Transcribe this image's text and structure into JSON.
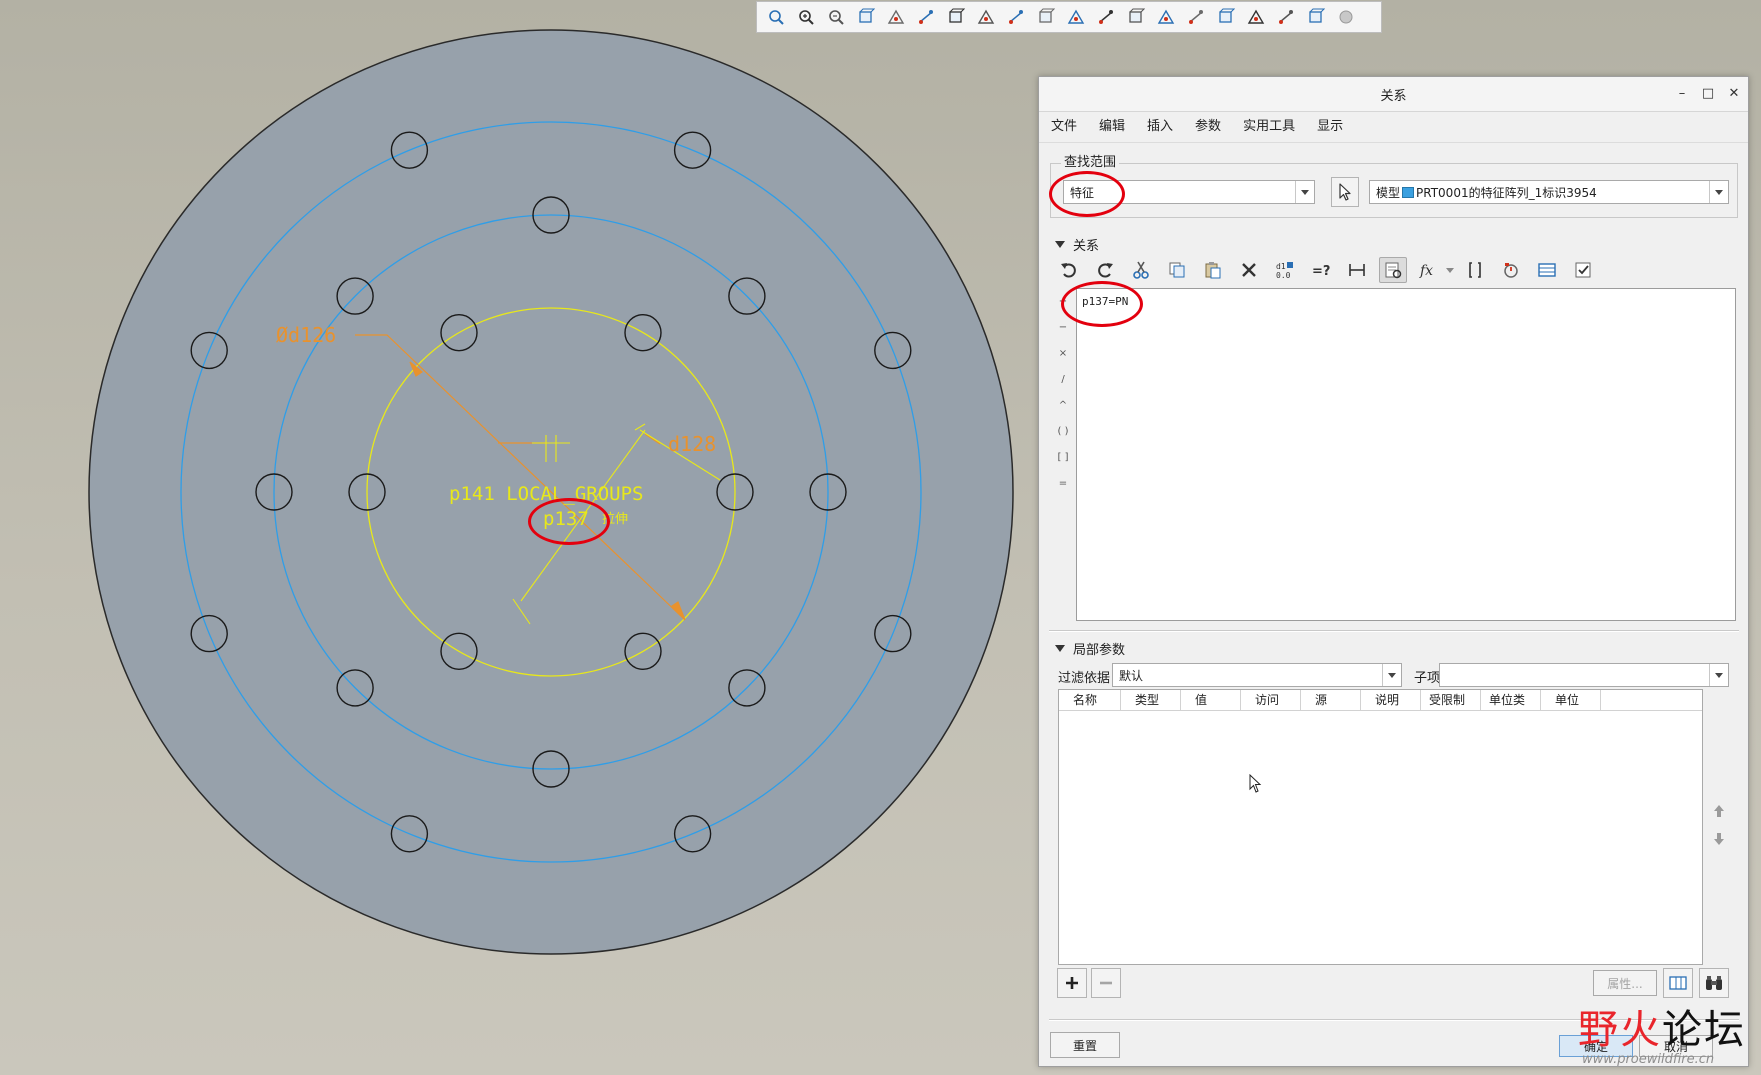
{
  "colors": {
    "disc": "#97a1ab",
    "hole_stroke": "#1a1a1a",
    "bolt_circle": "#2f9ee8",
    "sketch": "#e8e81a",
    "dimension": "#e8922e",
    "highlight": "#e3000e"
  },
  "model": {
    "dim_diameter_label": "Ød126",
    "dim_radius_label": "d128",
    "pattern_label": "p141 LOCAL_GROUPS",
    "param_label": "p137",
    "feature_label": "拉伸"
  },
  "view_toolbar": {
    "icons": [
      "refit-icon",
      "zoom-in-icon",
      "zoom-out-icon",
      "repaint-icon",
      "shading-icon",
      "display-style-icon",
      "saved-views-icon",
      "view-manager-icon",
      "section-icon",
      "perspective-icon",
      "appearance-icon",
      "datum-display-icon",
      "plane-display-icon",
      "axis-display-icon",
      "point-display-icon",
      "csys-display-icon",
      "annotation-display-icon",
      "spin-center-icon",
      "render-icon",
      "layer-icon"
    ]
  },
  "dialog": {
    "title": "关系",
    "window_buttons": {
      "minimize": "–",
      "maximize": "□",
      "close": "✕"
    },
    "menu": [
      "文件",
      "编辑",
      "插入",
      "参数",
      "实用工具",
      "显示"
    ],
    "lookup": {
      "legend": "查找范围",
      "type_value": "特征",
      "object_prefix": "模型",
      "object_value": "PRT0001的特征阵列_1标识3954"
    },
    "relations": {
      "header": "关系",
      "text": "p137=PN",
      "ops": [
        "+",
        "−",
        "×",
        "/",
        "^",
        "( )",
        "[ ]",
        "="
      ]
    },
    "local_params": {
      "header": "局部参数",
      "filter_label": "过滤依据",
      "filter_value": "默认",
      "subitem_label": "子项",
      "subitem_value": "",
      "columns": [
        "名称",
        "类型",
        "值",
        "访问",
        "源",
        "说明",
        "受限制",
        "单位类",
        "单位"
      ],
      "properties_label": "属性..."
    },
    "buttons": {
      "reset": "重置",
      "ok": "确定",
      "cancel": "取消"
    }
  },
  "watermark": {
    "red": "野火",
    "black": "论坛",
    "url": "www.proewildfire.cn"
  }
}
